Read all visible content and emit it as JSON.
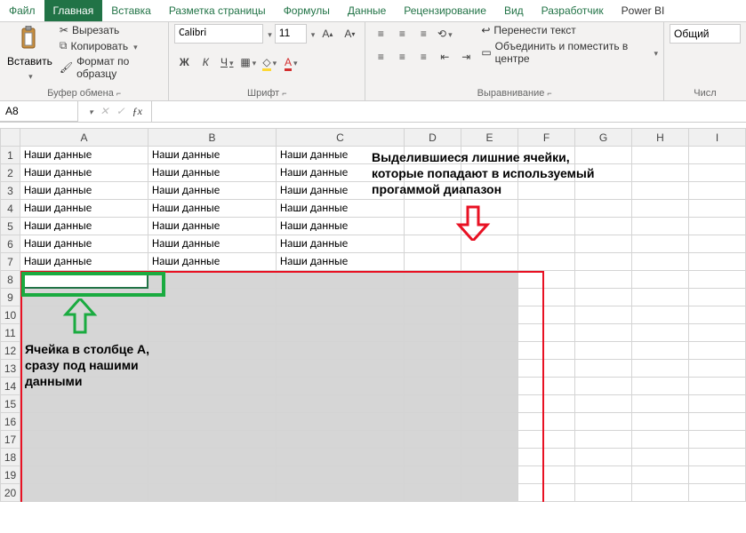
{
  "tabs": {
    "file": "Файл",
    "home": "Главная",
    "insert": "Вставка",
    "page_layout": "Разметка страницы",
    "formulas": "Формулы",
    "data": "Данные",
    "review": "Рецензирование",
    "view": "Вид",
    "developer": "Разработчик",
    "powerbi": "Power BI"
  },
  "clipboard": {
    "paste": "Вставить",
    "cut": "Вырезать",
    "copy": "Копировать",
    "format_painter": "Формат по образцу",
    "group_label": "Буфер обмена"
  },
  "font": {
    "name": "Calibri",
    "size": "11",
    "bold": "Ж",
    "italic": "К",
    "underline": "Ч",
    "group_label": "Шрифт"
  },
  "alignment": {
    "wrap": "Перенести текст",
    "merge": "Объединить и поместить в центре",
    "group_label": "Выравнивание"
  },
  "number": {
    "format": "Общий",
    "group_label": "Числ"
  },
  "namebox": "A8",
  "columns": [
    "A",
    "B",
    "C",
    "D",
    "E",
    "F",
    "G",
    "H",
    "I"
  ],
  "rows": [
    1,
    2,
    3,
    4,
    5,
    6,
    7,
    8,
    9,
    10,
    11,
    12,
    13,
    14,
    15,
    16,
    17,
    18,
    19,
    20
  ],
  "cell_text": "Наши данные",
  "data_rows": 7,
  "data_cols": 3,
  "selection_start_row": 8,
  "annotations": {
    "top": "Выделившиеся лишние ячейки, которые попадают в используемый прогаммой диапазон",
    "left": "Ячейка в столбце А, сразу под нашими данными"
  }
}
